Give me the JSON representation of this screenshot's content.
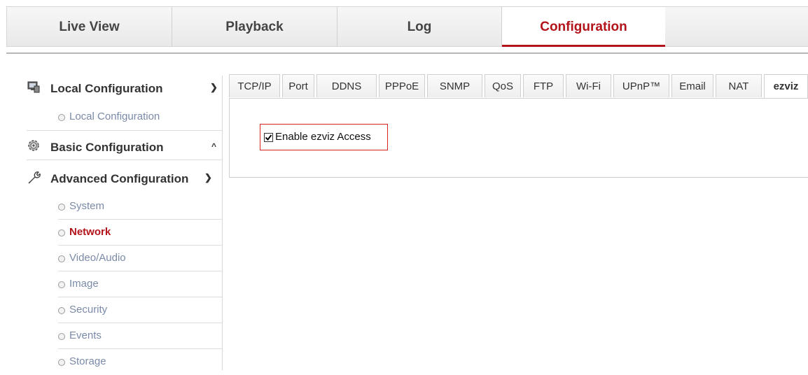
{
  "top_nav": {
    "tabs": [
      {
        "label": "Live View"
      },
      {
        "label": "Playback"
      },
      {
        "label": "Log"
      },
      {
        "label": "Configuration"
      }
    ],
    "active_tab": "Configuration",
    "accent_color": "#b3141b"
  },
  "sidebar": {
    "local": {
      "title": "Local Configuration",
      "icon": "monitor-icon",
      "items": [
        "Local Configuration"
      ]
    },
    "basic": {
      "title": "Basic Configuration",
      "icon": "settings-icon"
    },
    "advanced": {
      "title": "Advanced Configuration",
      "icon": "wrench-icon",
      "items": [
        "System",
        "Network",
        "Video/Audio",
        "Image",
        "Security",
        "Events",
        "Storage"
      ],
      "active_item": "Network"
    }
  },
  "sub_tabs": {
    "labels": [
      "TCP/IP",
      "Port",
      "DDNS",
      "PPPoE",
      "SNMP",
      "QoS",
      "FTP",
      "Wi-Fi",
      "UPnP™",
      "Email",
      "NAT",
      "ezviz"
    ],
    "active": "ezviz"
  },
  "form": {
    "enable_ezviz_label": "Enable ezviz Access",
    "enable_ezviz_checked": true
  }
}
